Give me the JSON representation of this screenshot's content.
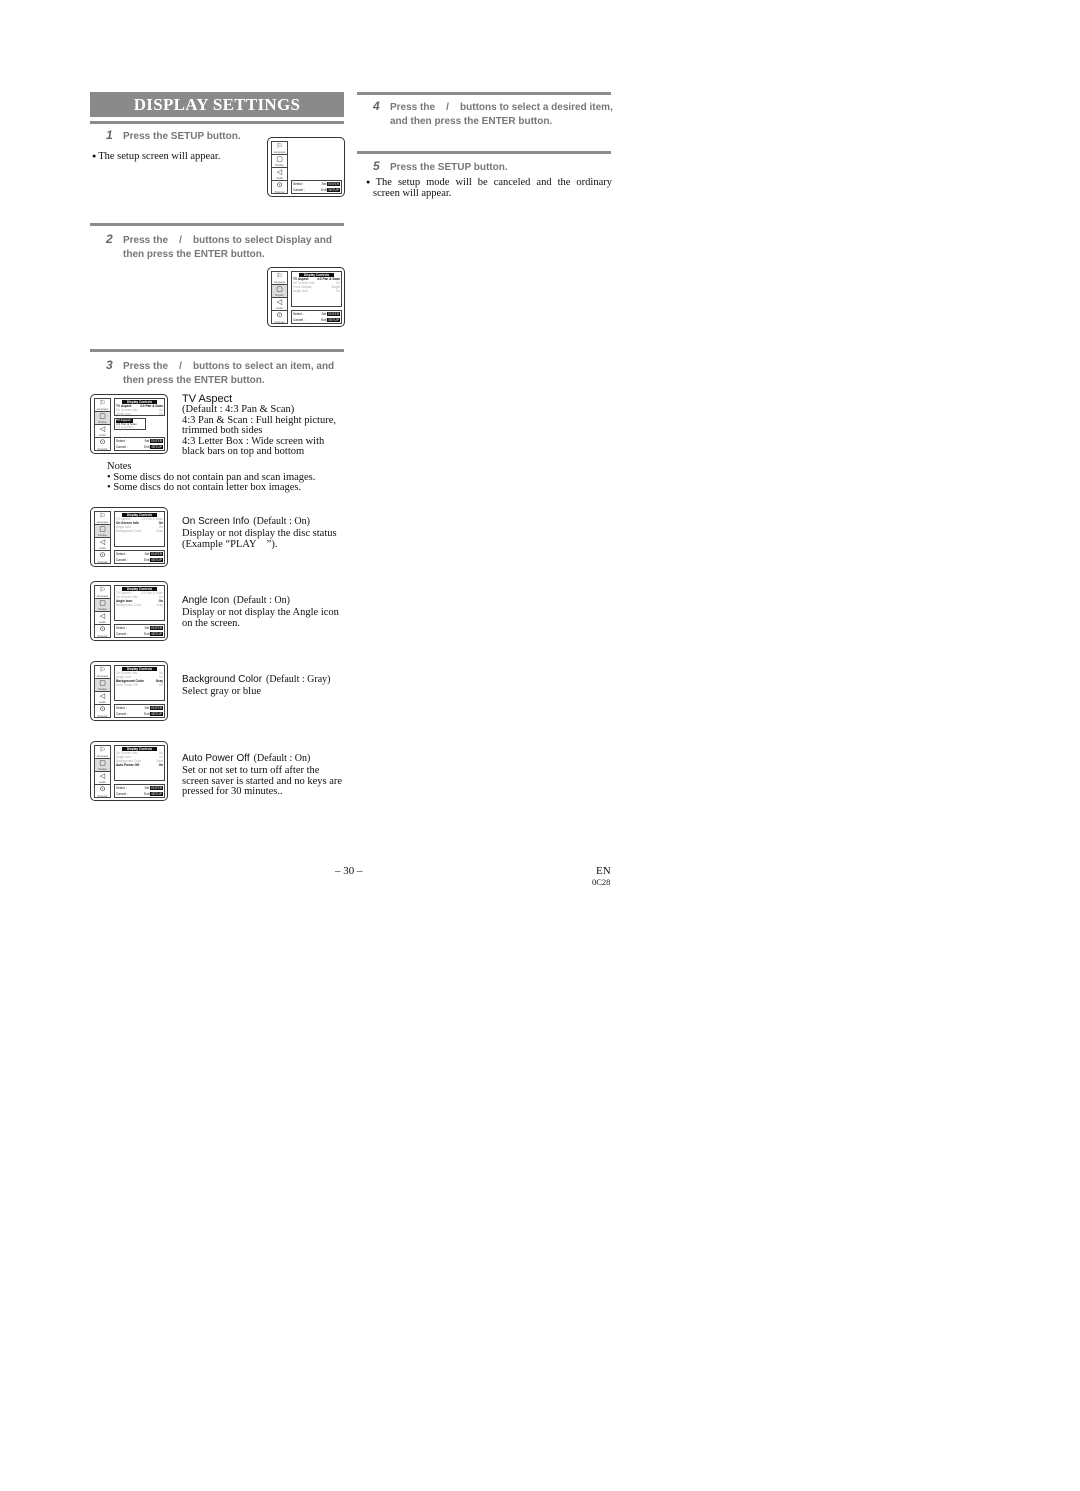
{
  "section_title": "DISPLAY SETTINGS",
  "steps": [
    {
      "num": "1",
      "line1": "Press the SETUP button.",
      "line2": ""
    },
    {
      "num": "2",
      "line1": "Press the    /    buttons to select Display and",
      "line2": "then press the ENTER button."
    },
    {
      "num": "3",
      "line1": "Press the    /    buttons to select an item, and",
      "line2": "then press the ENTER button."
    },
    {
      "num": "4",
      "line1": "Press the    /    buttons to select a desired item,",
      "line2": "and then press the ENTER button."
    },
    {
      "num": "5",
      "line1": "Press the SETUP button.",
      "line2": ""
    }
  ],
  "step1_bullet": "The setup screen will appear.",
  "step5_bullet_line1": "The setup mode will be canceled and the ordinary",
  "step5_bullet_line2": "screen will appear.",
  "screen": {
    "side_icons": [
      {
        "icon": "flag-icon",
        "glyph": "⚐",
        "label": "Language"
      },
      {
        "icon": "monitor-icon",
        "glyph": "▢",
        "label": "Display"
      },
      {
        "icon": "speaker-icon",
        "glyph": "◁",
        "label": "Audio"
      },
      {
        "icon": "lock-icon",
        "glyph": "⊙",
        "label": "Parental"
      }
    ],
    "panel_header": "Display Controls",
    "footer": {
      "select": "Select :",
      "set": "Set",
      "set_key": "ENTER",
      "cancel": "Cancel :",
      "exit": "Exit",
      "exit_key": "SETUP"
    },
    "rows_step2": [
      {
        "name": "TV Aspect",
        "value": "4:3 Pan & Scan"
      },
      {
        "name": "On Screen Info",
        "value": "On"
      },
      {
        "name": "Front Display",
        "value": "Bright"
      },
      {
        "name": "Angle Icon",
        "value": "On"
      }
    ],
    "rows_full": [
      {
        "name": "TV Aspect",
        "value": "4:3 Pan & Scan"
      },
      {
        "name": "On Screen Info",
        "value": "On"
      },
      {
        "name": "Angle Icon",
        "value": "On"
      },
      {
        "name": "Background Color",
        "value": "Gray"
      }
    ],
    "rows_last": [
      {
        "name": "On Screen Info",
        "value": "On"
      },
      {
        "name": "Angle Icon",
        "value": "On"
      },
      {
        "name": "Background Color",
        "value": "Gray"
      },
      {
        "name": "Auto Power Off",
        "value": "On"
      }
    ],
    "rows_last2": [
      {
        "name": "On Screen Info",
        "value": "On"
      },
      {
        "name": "Angle Icon",
        "value": "On"
      },
      {
        "name": "Background Color",
        "value": "Blue"
      },
      {
        "name": "Auto Power Off",
        "value": "On"
      }
    ],
    "sub_header": "TV Aspect",
    "sub_options": [
      "4:3 Pan & Scan",
      "4:3 LetterBox"
    ]
  },
  "items": [
    {
      "title": "TV Aspect",
      "default": "",
      "lines": [
        "(Default : 4:3 Pan & Scan)",
        "4:3 Pan & Scan : Full height picture,",
        "trimmed both sides",
        "4:3 Letter Box : Wide screen with",
        "black bars on top and bottom"
      ]
    },
    {
      "title": "On Screen Info",
      "default": "(Default : On)",
      "lines": [
        "Display or not display the disc status",
        "(Example “PLAY    ”)."
      ]
    },
    {
      "title": "Angle Icon",
      "default": "(Default : On)",
      "lines": [
        "Display or not display the Angle icon",
        "on the screen."
      ]
    },
    {
      "title": "Background Color",
      "default": "(Default : Gray)",
      "lines": [
        "Select gray or blue"
      ]
    },
    {
      "title": "Auto Power Off",
      "default": "(Default : On)",
      "lines": [
        "Set or not set to turn off after the",
        "screen saver is started and no keys are",
        "pressed for 30 minutes.."
      ]
    }
  ],
  "notes": {
    "heading": "Notes",
    "items": [
      "Some discs do not contain pan and scan images.",
      "Some discs do not contain letter box images."
    ]
  },
  "footer": {
    "page_number": "– 30 –",
    "lang": "EN",
    "code": "0C28"
  }
}
